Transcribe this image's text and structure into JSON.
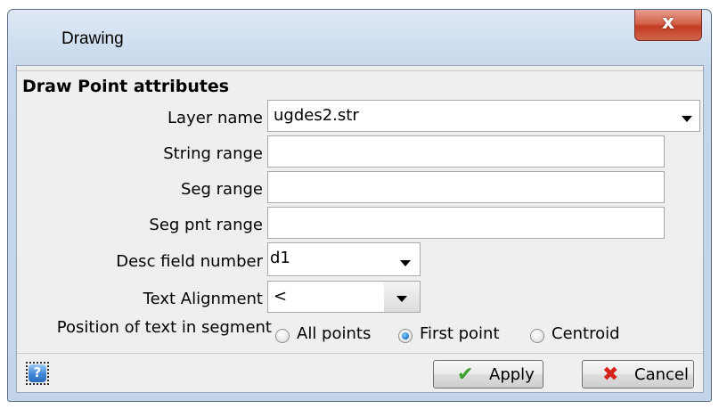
{
  "window": {
    "title": "Drawing",
    "close_icon": "close-x-icon"
  },
  "section": {
    "title": "Draw Point attributes"
  },
  "fields": {
    "layer_name": {
      "label": "Layer name",
      "value": "ugdes2.str"
    },
    "string_range": {
      "label": "String range",
      "value": ""
    },
    "seg_range": {
      "label": "Seg range",
      "value": ""
    },
    "seg_pnt_range": {
      "label": "Seg pnt range",
      "value": ""
    },
    "desc_field_number": {
      "label": "Desc field number",
      "value": "d1"
    },
    "text_alignment": {
      "label": "Text Alignment",
      "value": "<"
    }
  },
  "position": {
    "label": "Position of text in segment",
    "options": [
      "All points",
      "First point",
      "Centroid"
    ],
    "selected": "First point"
  },
  "buttons": {
    "help_icon": "help-question-icon",
    "help_glyph": "?",
    "apply": "Apply",
    "apply_icon": "check-icon",
    "cancel": "Cancel",
    "cancel_icon": "red-x-icon"
  },
  "colors": {
    "close_button": "#c13b22",
    "apply_check": "#3aa02a",
    "cancel_x": "#d6231a",
    "radio_selected": "#1a78c2"
  }
}
